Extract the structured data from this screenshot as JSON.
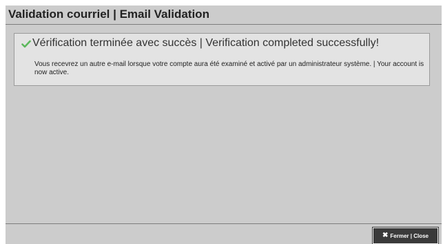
{
  "dialog": {
    "title": "Validation courriel | Email Validation"
  },
  "message": {
    "icon": "checkmark-icon",
    "heading": "Vérification terminée avec succès | Verification completed successfully!",
    "body": "Vous recevrez un autre e-mail lorsque votre compte aura été examiné et activé par un administrateur système. | Your account is now active."
  },
  "footer": {
    "close_icon": "close-icon",
    "close_label": "Fermer | Close"
  },
  "colors": {
    "success": "#5cb85c",
    "dialog_background": "#cccccc",
    "message_background": "#e3e3e3",
    "button_background": "#3a3a3a"
  }
}
